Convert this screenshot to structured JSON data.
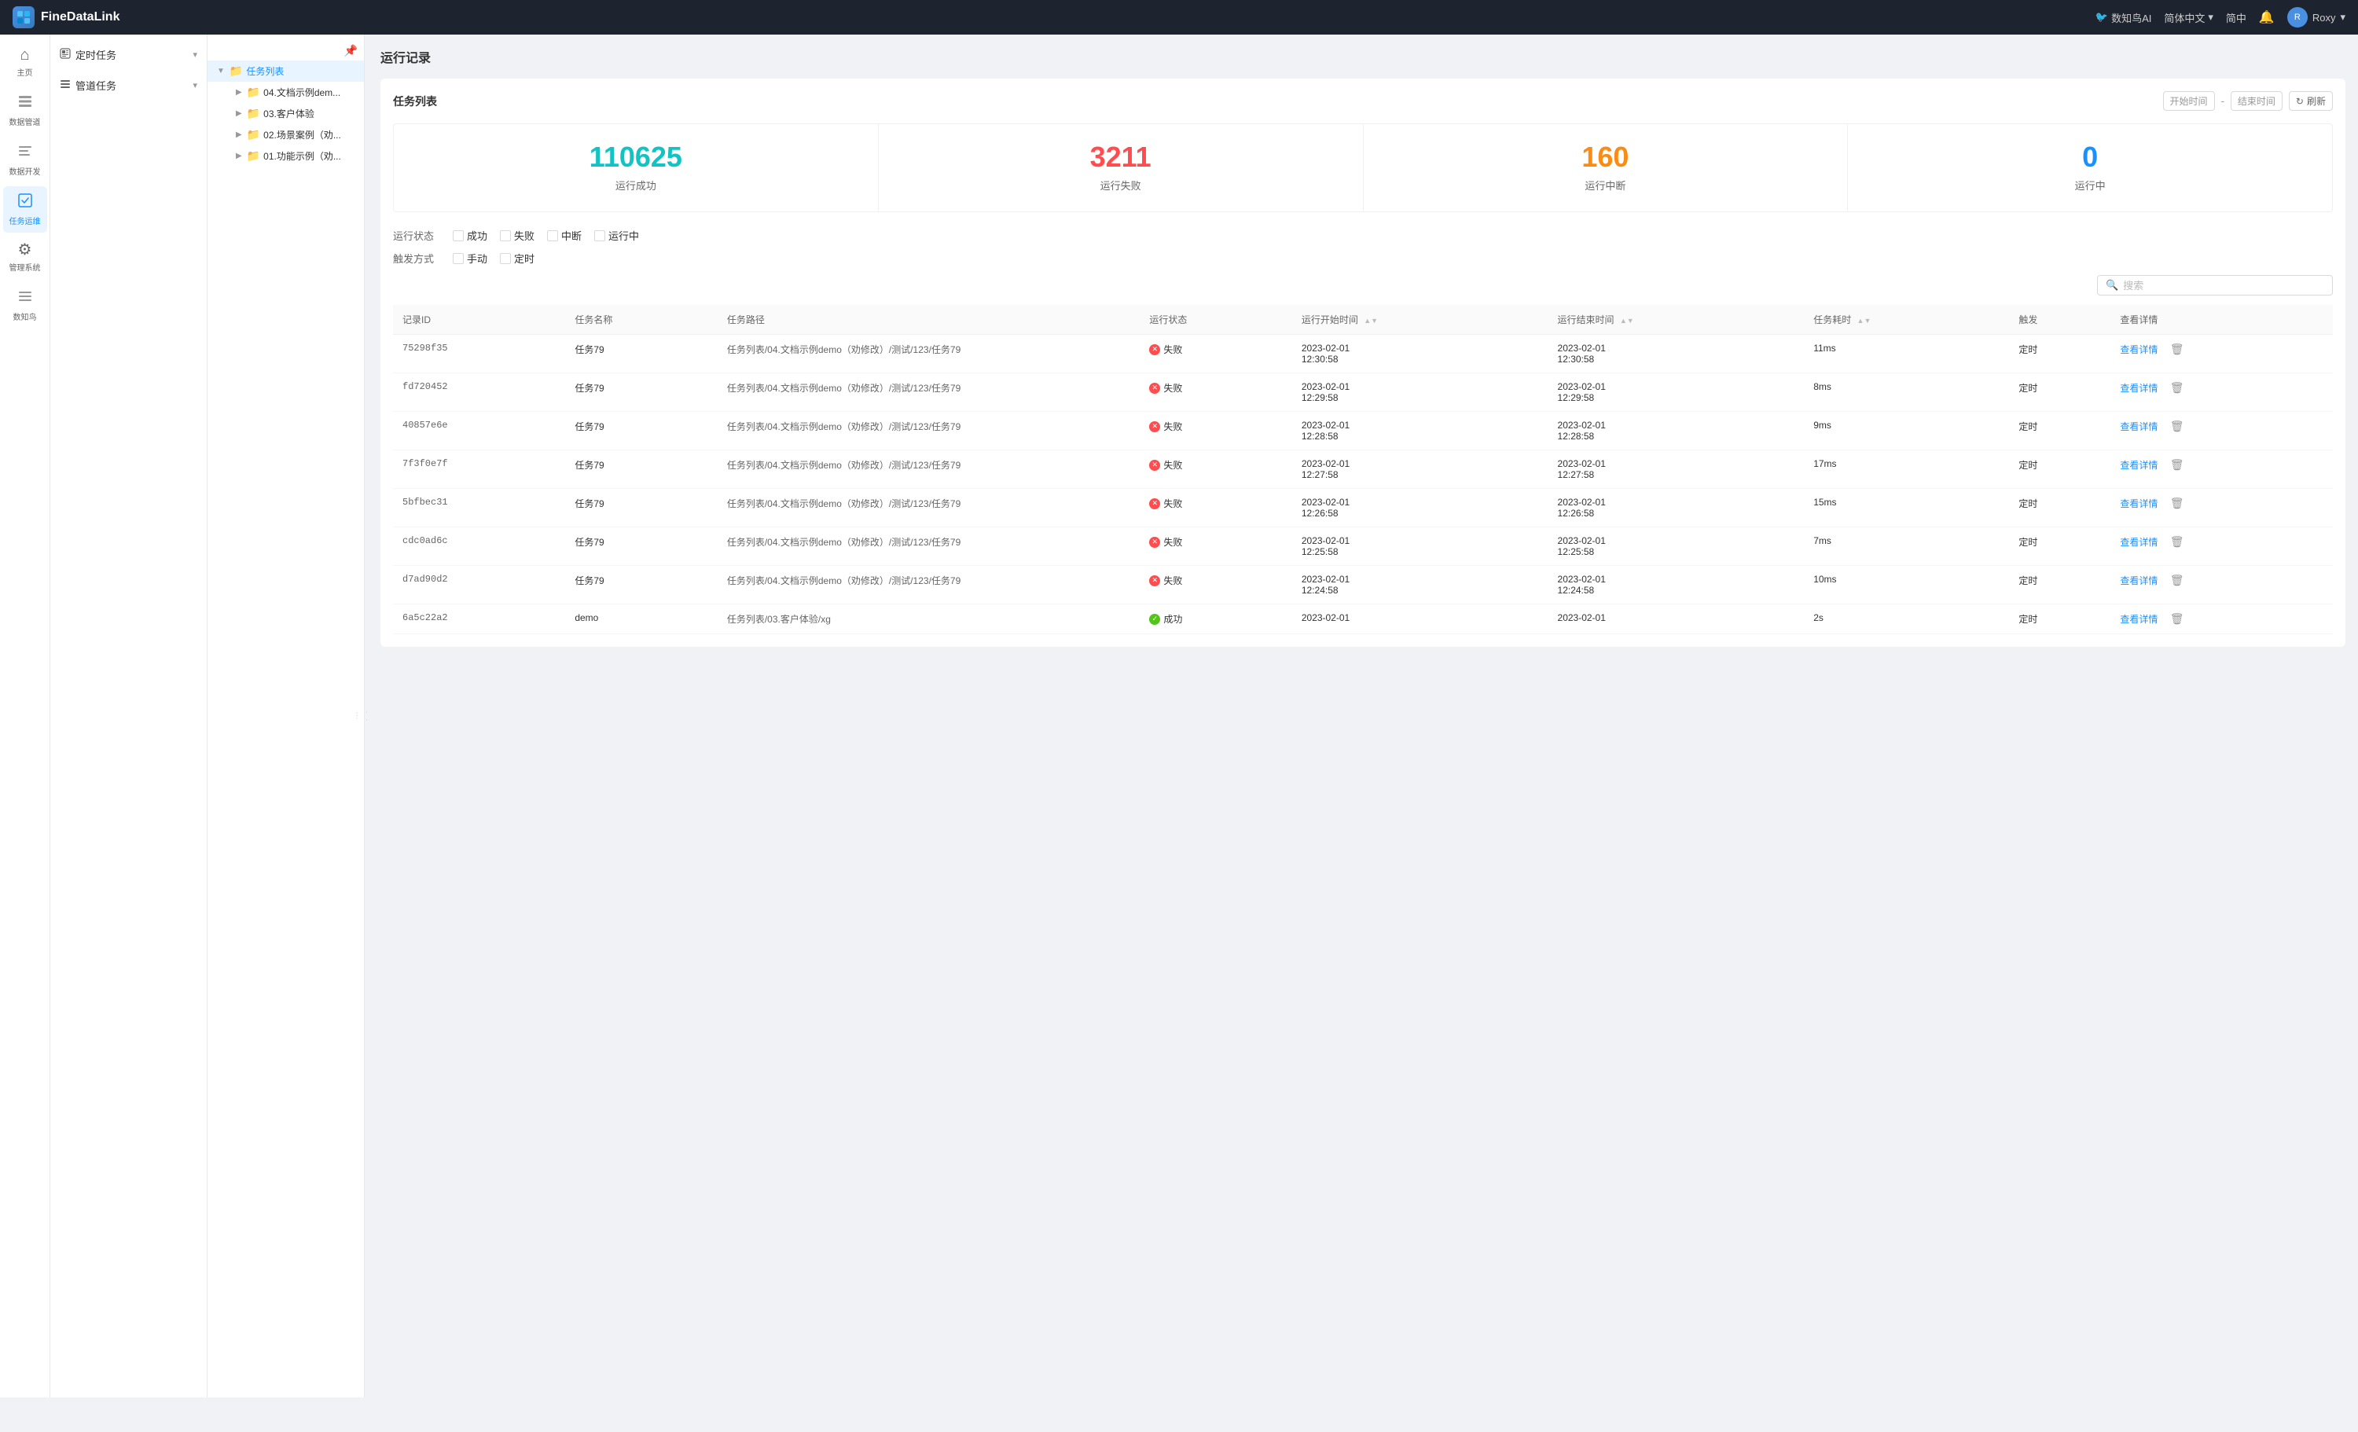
{
  "app": {
    "name": "FineDataLink",
    "logo_text": "FDL"
  },
  "topnav": {
    "ai_label": "数知鸟AI",
    "lang_label": "简体中文",
    "simple_label": "简中",
    "user_name": "Roxy"
  },
  "sidebar_icons": [
    {
      "id": "home",
      "icon": "⌂",
      "label": "主页",
      "active": false
    },
    {
      "id": "data-pipeline",
      "icon": "⊟",
      "label": "数据管道",
      "active": false
    },
    {
      "id": "data-dev",
      "icon": "≡",
      "label": "数据开发",
      "active": false
    },
    {
      "id": "task-ops",
      "icon": "✓",
      "label": "任务运维",
      "active": true
    },
    {
      "id": "manage",
      "icon": "⚙",
      "label": "管理系统",
      "active": false
    },
    {
      "id": "zhiniaobird",
      "icon": "≡",
      "label": "数知鸟",
      "active": false
    }
  ],
  "sidebar_menus": [
    {
      "id": "scheduled",
      "icon": "⊞",
      "label": "定时任务",
      "expanded": true
    },
    {
      "id": "pipeline",
      "icon": "⊟",
      "label": "管道任务",
      "expanded": true
    }
  ],
  "tree": {
    "root_label": "任务列表",
    "root_selected": true,
    "items": [
      {
        "id": "doc-demo",
        "label": "04.文档示例dem...",
        "expanded": false
      },
      {
        "id": "customer",
        "label": "03.客户体验",
        "expanded": false
      },
      {
        "id": "scenario",
        "label": "02.场景案例（劝...",
        "expanded": false
      },
      {
        "id": "feature",
        "label": "01.功能示例（劝...",
        "expanded": false
      }
    ]
  },
  "page": {
    "title": "运行记录"
  },
  "task_panel": {
    "title": "任务列表",
    "start_time_placeholder": "开始时间",
    "end_time_placeholder": "结束时间",
    "refresh_label": "刷新"
  },
  "stats": [
    {
      "id": "success",
      "value": "110625",
      "label": "运行成功",
      "color_class": "success"
    },
    {
      "id": "failed",
      "value": "3211",
      "label": "运行失败",
      "color_class": "failed"
    },
    {
      "id": "interrupted",
      "value": "160",
      "label": "运行中断",
      "color_class": "interrupted"
    },
    {
      "id": "running",
      "value": "0",
      "label": "运行中",
      "color_class": "running"
    }
  ],
  "filters": {
    "status_label": "运行状态",
    "trigger_label": "触发方式",
    "status_options": [
      "成功",
      "失败",
      "中断",
      "运行中"
    ],
    "trigger_options": [
      "手动",
      "定时"
    ]
  },
  "search": {
    "placeholder": "搜索"
  },
  "table": {
    "columns": [
      {
        "id": "record-id",
        "label": "记录ID"
      },
      {
        "id": "task-name",
        "label": "任务名称"
      },
      {
        "id": "task-path",
        "label": "任务路径"
      },
      {
        "id": "run-status",
        "label": "运行状态"
      },
      {
        "id": "start-time",
        "label": "运行开始时间"
      },
      {
        "id": "end-time",
        "label": "运行结束时间"
      },
      {
        "id": "duration",
        "label": "任务耗时"
      },
      {
        "id": "trigger",
        "label": "触发"
      },
      {
        "id": "detail",
        "label": "查看详情"
      }
    ],
    "rows": [
      {
        "record_id": "75298f35",
        "task_name": "任务79",
        "task_path": "任务列表/04.文档示例demo（劝修改）/测试/123/任务79",
        "status": "失败",
        "status_type": "failed",
        "start_time": "2023-02-01\n12:30:58",
        "end_time": "2023-02-01\n12:30:58",
        "duration": "11ms",
        "trigger": "定时",
        "detail_label": "查看详情"
      },
      {
        "record_id": "fd720452",
        "task_name": "任务79",
        "task_path": "任务列表/04.文档示例demo（劝修改）/测试/123/任务79",
        "status": "失败",
        "status_type": "failed",
        "start_time": "2023-02-01\n12:29:58",
        "end_time": "2023-02-01\n12:29:58",
        "duration": "8ms",
        "trigger": "定时",
        "detail_label": "查看详情"
      },
      {
        "record_id": "40857e6e",
        "task_name": "任务79",
        "task_path": "任务列表/04.文档示例demo（劝修改）/测试/123/任务79",
        "status": "失败",
        "status_type": "failed",
        "start_time": "2023-02-01\n12:28:58",
        "end_time": "2023-02-01\n12:28:58",
        "duration": "9ms",
        "trigger": "定时",
        "detail_label": "查看详情"
      },
      {
        "record_id": "7f3f0e7f",
        "task_name": "任务79",
        "task_path": "任务列表/04.文档示例demo（劝修改）/测试/123/任务79",
        "status": "失败",
        "status_type": "failed",
        "start_time": "2023-02-01\n12:27:58",
        "end_time": "2023-02-01\n12:27:58",
        "duration": "17ms",
        "trigger": "定时",
        "detail_label": "查看详情"
      },
      {
        "record_id": "5bfbec31",
        "task_name": "任务79",
        "task_path": "任务列表/04.文档示例demo（劝修改）/测试/123/任务79",
        "status": "失败",
        "status_type": "failed",
        "start_time": "2023-02-01\n12:26:58",
        "end_time": "2023-02-01\n12:26:58",
        "duration": "15ms",
        "trigger": "定时",
        "detail_label": "查看详情"
      },
      {
        "record_id": "cdc0ad6c",
        "task_name": "任务79",
        "task_path": "任务列表/04.文档示例demo（劝修改）/测试/123/任务79",
        "status": "失败",
        "status_type": "failed",
        "start_time": "2023-02-01\n12:25:58",
        "end_time": "2023-02-01\n12:25:58",
        "duration": "7ms",
        "trigger": "定时",
        "detail_label": "查看详情"
      },
      {
        "record_id": "d7ad90d2",
        "task_name": "任务79",
        "task_path": "任务列表/04.文档示例demo（劝修改）/测试/123/任务79",
        "status": "失败",
        "status_type": "failed",
        "start_time": "2023-02-01\n12:24:58",
        "end_time": "2023-02-01\n12:24:58",
        "duration": "10ms",
        "trigger": "定时",
        "detail_label": "查看详情"
      },
      {
        "record_id": "6a5c22a2",
        "task_name": "demo",
        "task_path": "任务列表/03.客户体验/xg",
        "status": "成功",
        "status_type": "success",
        "start_time": "2023-02-01\n",
        "end_time": "2023-02-01\n",
        "duration": "2s",
        "trigger": "定时",
        "detail_label": "查看详情"
      }
    ]
  }
}
